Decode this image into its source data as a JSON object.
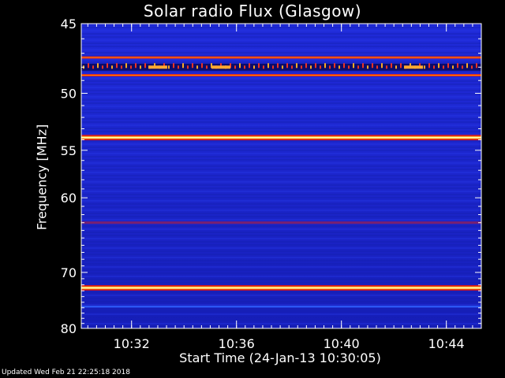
{
  "title": "Solar radio Flux (Glasgow)",
  "footer": "Updated Wed Feb 21 22:25:18 2018",
  "chart_data": {
    "type": "heatmap",
    "title": "Solar radio Flux (Glasgow)",
    "ylabel": "Frequency [MHz]",
    "xlabel": "Start Time (24-Jan-13 10:30:05)",
    "ylim": [
      45,
      80
    ],
    "xlim": [
      "10:30:05",
      "10:45:20"
    ],
    "y_scale": "log",
    "y_ticks": [
      45,
      50,
      55,
      60,
      70,
      80
    ],
    "x_ticks": [
      "10:32",
      "10:36",
      "10:40",
      "10:44"
    ],
    "colormap": [
      "#000033",
      "#1a1acc",
      "#2233ff",
      "#cc2233",
      "#ff4400",
      "#ffcc33",
      "#ffffcc"
    ],
    "bands": [
      {
        "freq": 47.3,
        "intensity": "high"
      },
      {
        "freq": 48.0,
        "intensity": "bursty"
      },
      {
        "freq": 48.6,
        "intensity": "high"
      },
      {
        "freq": 53.8,
        "intensity": "very-high"
      },
      {
        "freq": 63.0,
        "intensity": "medium"
      },
      {
        "freq": 72.5,
        "intensity": "very-high"
      },
      {
        "freq": 75.8,
        "intensity": "low"
      }
    ]
  }
}
